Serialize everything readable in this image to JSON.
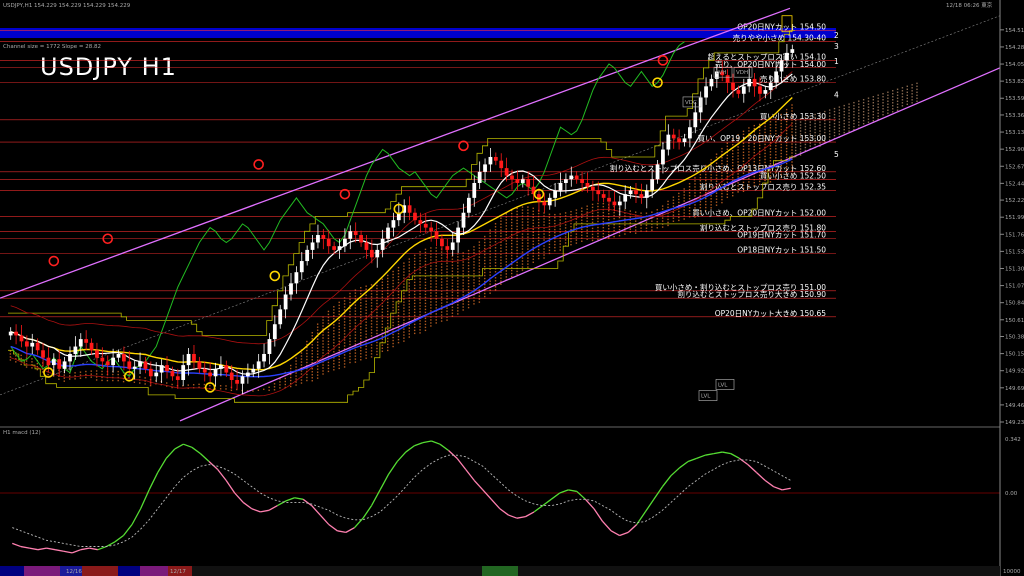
{
  "header": {
    "symbol_info": "USDJPY,H1  154.229 154.229 154.229 154.229",
    "datetime": "12/18 06:26 東京",
    "channel_info": "Channel size = 1772  Slope = 28.82",
    "big_title": "USDJPY H1",
    "sub_label": "H1  macd (12)"
  },
  "colors": {
    "bg": "#000000",
    "bull": "#ffffff",
    "bear": "#ff1a1a",
    "channel": "#e070ff",
    "ma_fast": "#ffffff",
    "ma_mid": "#ffd700",
    "ma_slow": "#2a40ff",
    "chikou": "#22bb22",
    "macd": "#55dd33",
    "signal": "#bbbbbb",
    "macd_lower": "#ff80b0",
    "level": "#ff3030",
    "sr_band": "#0000cc"
  },
  "chart_data": [
    {
      "type": "candlestick",
      "title": "USDJPY H1",
      "ylim": [
        149.235,
        154.75
      ],
      "y_ticks": [
        "154.510",
        "154.280",
        "154.050",
        "153.820",
        "153.590",
        "153.365",
        "153.135",
        "152.905",
        "152.675",
        "152.445",
        "152.220",
        "151.990",
        "151.760",
        "151.530",
        "151.300",
        "151.070",
        "150.840",
        "150.610",
        "150.385",
        "150.155",
        "149.925",
        "149.695",
        "149.465",
        "149.235"
      ],
      "x_ticks": [
        "12/16",
        "12/17"
      ],
      "closes": [
        150.45,
        150.4,
        150.32,
        150.25,
        150.3,
        150.2,
        150.1,
        150.0,
        150.08,
        149.95,
        150.05,
        150.15,
        150.25,
        150.35,
        150.3,
        150.2,
        150.1,
        150.05,
        150.0,
        150.1,
        150.15,
        150.05,
        149.95,
        149.98,
        150.05,
        149.95,
        149.85,
        149.9,
        150.0,
        149.92,
        149.85,
        149.8,
        150.0,
        150.15,
        150.05,
        149.95,
        149.9,
        149.85,
        149.95,
        150.0,
        149.9,
        149.8,
        149.75,
        149.85,
        149.9,
        149.95,
        150.05,
        150.15,
        150.35,
        150.55,
        150.75,
        150.95,
        151.1,
        151.25,
        151.4,
        151.55,
        151.65,
        151.75,
        151.7,
        151.6,
        151.55,
        151.6,
        151.7,
        151.8,
        151.75,
        151.65,
        151.55,
        151.45,
        151.55,
        151.7,
        151.85,
        151.95,
        152.05,
        152.15,
        152.05,
        151.95,
        151.9,
        151.85,
        151.8,
        151.7,
        151.6,
        151.55,
        151.65,
        151.85,
        152.05,
        152.25,
        152.45,
        152.6,
        152.7,
        152.8,
        152.75,
        152.65,
        152.55,
        152.5,
        152.45,
        152.5,
        152.4,
        152.3,
        152.2,
        152.15,
        152.25,
        152.35,
        152.45,
        152.5,
        152.55,
        152.5,
        152.45,
        152.4,
        152.35,
        152.3,
        152.25,
        152.2,
        152.15,
        152.2,
        152.3,
        152.35,
        152.3,
        152.25,
        152.35,
        152.5,
        152.7,
        152.9,
        153.1,
        153.05,
        153.0,
        153.05,
        153.2,
        153.4,
        153.6,
        153.75,
        153.85,
        153.95,
        153.9,
        153.8,
        153.7,
        153.65,
        153.75,
        153.85,
        153.75,
        153.65,
        153.7,
        153.8,
        153.95,
        154.1,
        154.2,
        154.25
      ],
      "levels": [
        {
          "label": "OP20日NYカット 154.50",
          "value": 154.5
        },
        {
          "label": "売りやや小さめ 154.30-40",
          "value": 154.35
        },
        {
          "label": "超えるとストップロス買い 154.10",
          "value": 154.1
        },
        {
          "label": "売り、OP20日NYカット 154.00",
          "value": 154.0
        },
        {
          "label": "売り小さめ 153.80",
          "value": 153.8
        },
        {
          "label": "買い小さめ 153.30",
          "value": 153.3
        },
        {
          "label": "買い、OP19・20日NYカット 153.00",
          "value": 153.0
        },
        {
          "label": "割り込むとストップロス売り小さめ、OP13日NYカット 152.60",
          "value": 152.6
        },
        {
          "label": "買い小さめ 152.50",
          "value": 152.5
        },
        {
          "label": "割り込むとストップロス売り 152.35",
          "value": 152.35
        },
        {
          "label": "買い小さめ、OP20日NYカット 152.00",
          "value": 152.0
        },
        {
          "label": "割り込むとストップロス売り 151.80",
          "value": 151.8
        },
        {
          "label": "OP19日NYカット 151.70",
          "value": 151.7
        },
        {
          "label": "OP18日NYカット 151.50",
          "value": 151.5
        },
        {
          "label": "買い小さめ・割り込むとストップロス売り 151.00",
          "value": 151.0
        },
        {
          "label": "割り込むとストップロス売り大きめ 150.90",
          "value": 150.9
        },
        {
          "label": "OP20日NYカット大きめ 150.65",
          "value": 150.65
        }
      ],
      "markers": {
        "up_value": 149.95,
        "up_shown_in_image": true,
        "down_value": 153.9,
        "down_shown_in_image": true,
        "labels": [
          "1",
          "2",
          "3",
          "4",
          "5"
        ],
        "boxes": [
          "LVH",
          "VDH",
          "VDC",
          "LVL",
          "LVL"
        ]
      }
    },
    {
      "type": "line",
      "title": "H1 macd (12)",
      "y_ticks": [
        "0.342",
        "0.00"
      ],
      "macd": [
        -0.32,
        -0.34,
        -0.35,
        -0.36,
        -0.35,
        -0.36,
        -0.37,
        -0.38,
        -0.36,
        -0.35,
        -0.36,
        -0.34,
        -0.31,
        -0.27,
        -0.2,
        -0.1,
        0.02,
        0.13,
        0.22,
        0.28,
        0.31,
        0.29,
        0.25,
        0.2,
        0.15,
        0.08,
        0.0,
        -0.06,
        -0.1,
        -0.12,
        -0.11,
        -0.08,
        -0.05,
        -0.03,
        -0.04,
        -0.08,
        -0.14,
        -0.2,
        -0.24,
        -0.25,
        -0.22,
        -0.16,
        -0.08,
        0.02,
        0.12,
        0.2,
        0.26,
        0.3,
        0.32,
        0.33,
        0.31,
        0.27,
        0.22,
        0.15,
        0.08,
        0.02,
        -0.04,
        -0.1,
        -0.14,
        -0.16,
        -0.15,
        -0.12,
        -0.08,
        -0.04,
        0.0,
        0.02,
        0.01,
        -0.04,
        -0.1,
        -0.18,
        -0.24,
        -0.27,
        -0.25,
        -0.2,
        -0.12,
        -0.04,
        0.04,
        0.11,
        0.16,
        0.2,
        0.22,
        0.24,
        0.25,
        0.26,
        0.25,
        0.22,
        0.18,
        0.13,
        0.08,
        0.04,
        0.02,
        0.03
      ],
      "signal": [
        -0.22,
        -0.24,
        -0.26,
        -0.28,
        -0.3,
        -0.31,
        -0.32,
        -0.33,
        -0.34,
        -0.34,
        -0.34,
        -0.34,
        -0.33,
        -0.31,
        -0.28,
        -0.23,
        -0.17,
        -0.1,
        -0.03,
        0.04,
        0.1,
        0.14,
        0.17,
        0.18,
        0.17,
        0.15,
        0.12,
        0.08,
        0.04,
        0.0,
        -0.03,
        -0.05,
        -0.06,
        -0.06,
        -0.06,
        -0.07,
        -0.09,
        -0.11,
        -0.14,
        -0.16,
        -0.17,
        -0.17,
        -0.15,
        -0.12,
        -0.07,
        -0.02,
        0.04,
        0.1,
        0.15,
        0.19,
        0.22,
        0.24,
        0.24,
        0.23,
        0.2,
        0.17,
        0.12,
        0.07,
        0.02,
        -0.02,
        -0.05,
        -0.07,
        -0.08,
        -0.08,
        -0.07,
        -0.05,
        -0.04,
        -0.04,
        -0.05,
        -0.08,
        -0.11,
        -0.15,
        -0.18,
        -0.19,
        -0.18,
        -0.15,
        -0.11,
        -0.06,
        -0.01,
        0.04,
        0.08,
        0.12,
        0.15,
        0.18,
        0.2,
        0.21,
        0.21,
        0.2,
        0.17,
        0.14,
        0.11,
        0.08
      ]
    }
  ],
  "footer": {
    "date_label_1": "12/16",
    "date_label_2": "12/17",
    "status": "10000"
  }
}
